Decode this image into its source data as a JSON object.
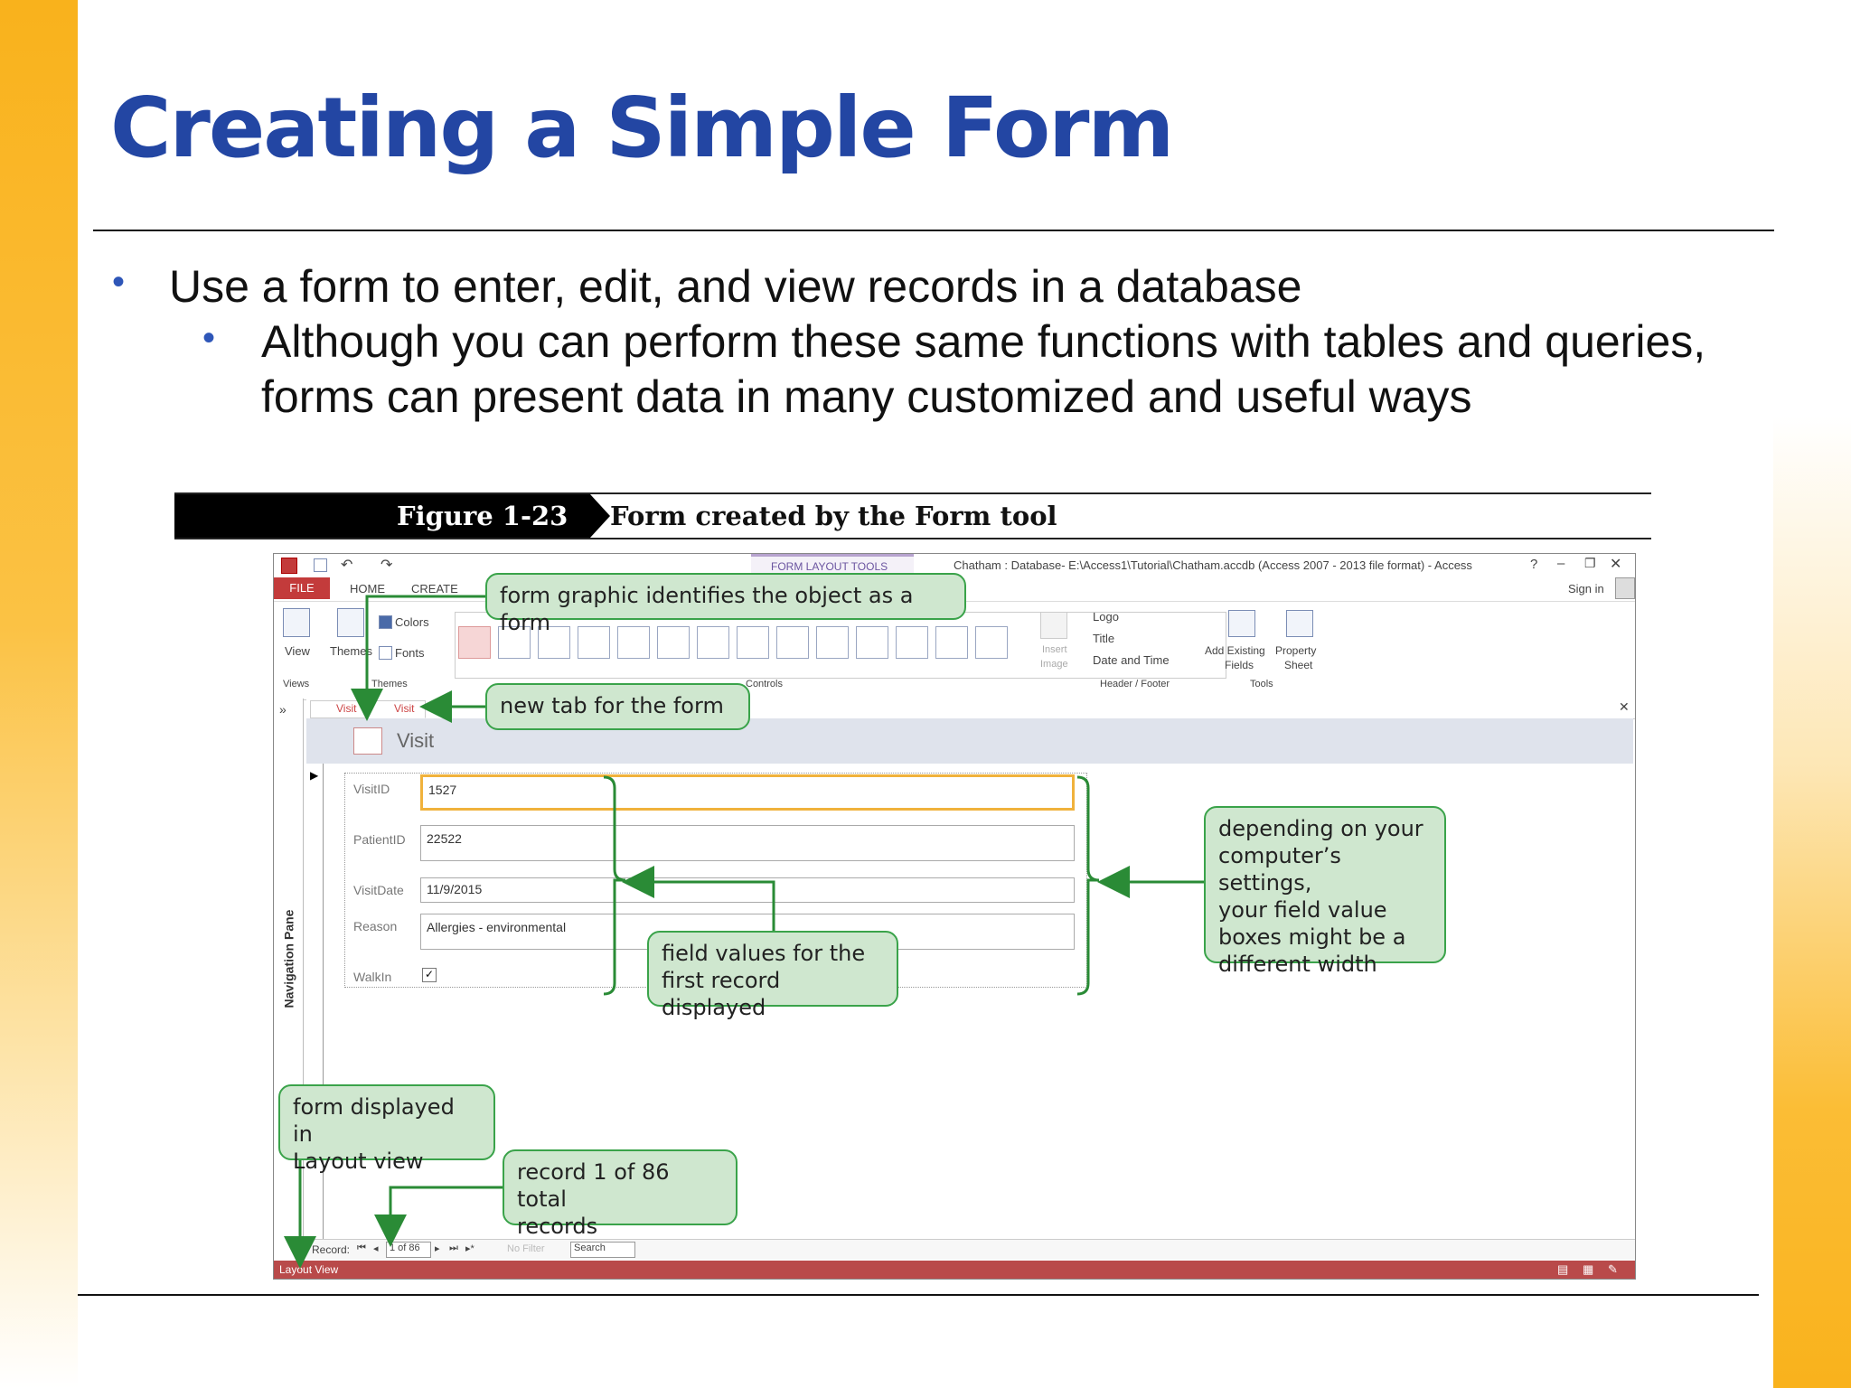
{
  "slide": {
    "title": "Creating a Simple Form",
    "bullet1": "Use a form to enter, edit, and view records in a database",
    "bullet2": "Although you can perform these same functions with tables and queries,",
    "bullet2b": "forms can present data in many customized and useful ways"
  },
  "figure": {
    "number": "Figure 1-23",
    "caption": "Form created by the Form tool"
  },
  "window": {
    "tools_label": "FORM LAYOUT TOOLS",
    "title": "Chatham : Database- E:\\Access1\\Tutorial\\Chatham.accdb (Access 2007 - 2013 file format) - Access",
    "help": "?",
    "sign_in": "Sign in",
    "tabs": {
      "file": "FILE",
      "home": "HOME",
      "create": "CREATE"
    },
    "ribbon": {
      "view": "View",
      "themes": "Themes",
      "colors": "Colors",
      "fonts": "Fonts",
      "insert_image_1": "Insert",
      "insert_image_2": "Image",
      "logo": "Logo",
      "title_btn": "Title",
      "date_time": "Date and Time",
      "add_fields_1": "Add Existing",
      "add_fields_2": "Fields",
      "property_1": "Property",
      "property_2": "Sheet",
      "group_views": "Views",
      "group_themes": "Themes",
      "group_controls": "Controls",
      "group_header_footer": "Header / Footer",
      "group_tools": "Tools"
    },
    "doc_tabs": [
      "Visit",
      "Visit"
    ],
    "form_title": "Visit",
    "nav_pane": "Navigation Pane",
    "fields": [
      {
        "label": "VisitID",
        "value": "1527"
      },
      {
        "label": "PatientID",
        "value": "22522"
      },
      {
        "label": "VisitDate",
        "value": "11/9/2015"
      },
      {
        "label": "Reason",
        "value": "Allergies - environmental"
      },
      {
        "label": "WalkIn",
        "value": ""
      }
    ],
    "record_nav": {
      "record_label": "Record:",
      "position": "1 of 86",
      "filter": "No Filter",
      "search": "Search"
    },
    "status": "Layout View"
  },
  "callouts": {
    "graphic": "form graphic identifies the object as a form",
    "new_tab": "new tab for the form",
    "field_values_1": "field values for the",
    "field_values_2": "first record displayed",
    "width_1": "depending on your",
    "width_2": "computer’s settings,",
    "width_3": "your field value",
    "width_4": "boxes might be a",
    "width_5": "different width",
    "layout_1": "form displayed in",
    "layout_2": "Layout view",
    "record_1": "record 1 of 86 total",
    "record_2": "records"
  },
  "colors": {
    "title_blue": "#2346a3",
    "callout_fill": "#cfe7cf",
    "callout_border": "#3aa34a",
    "status_red": "#b94a4a"
  }
}
